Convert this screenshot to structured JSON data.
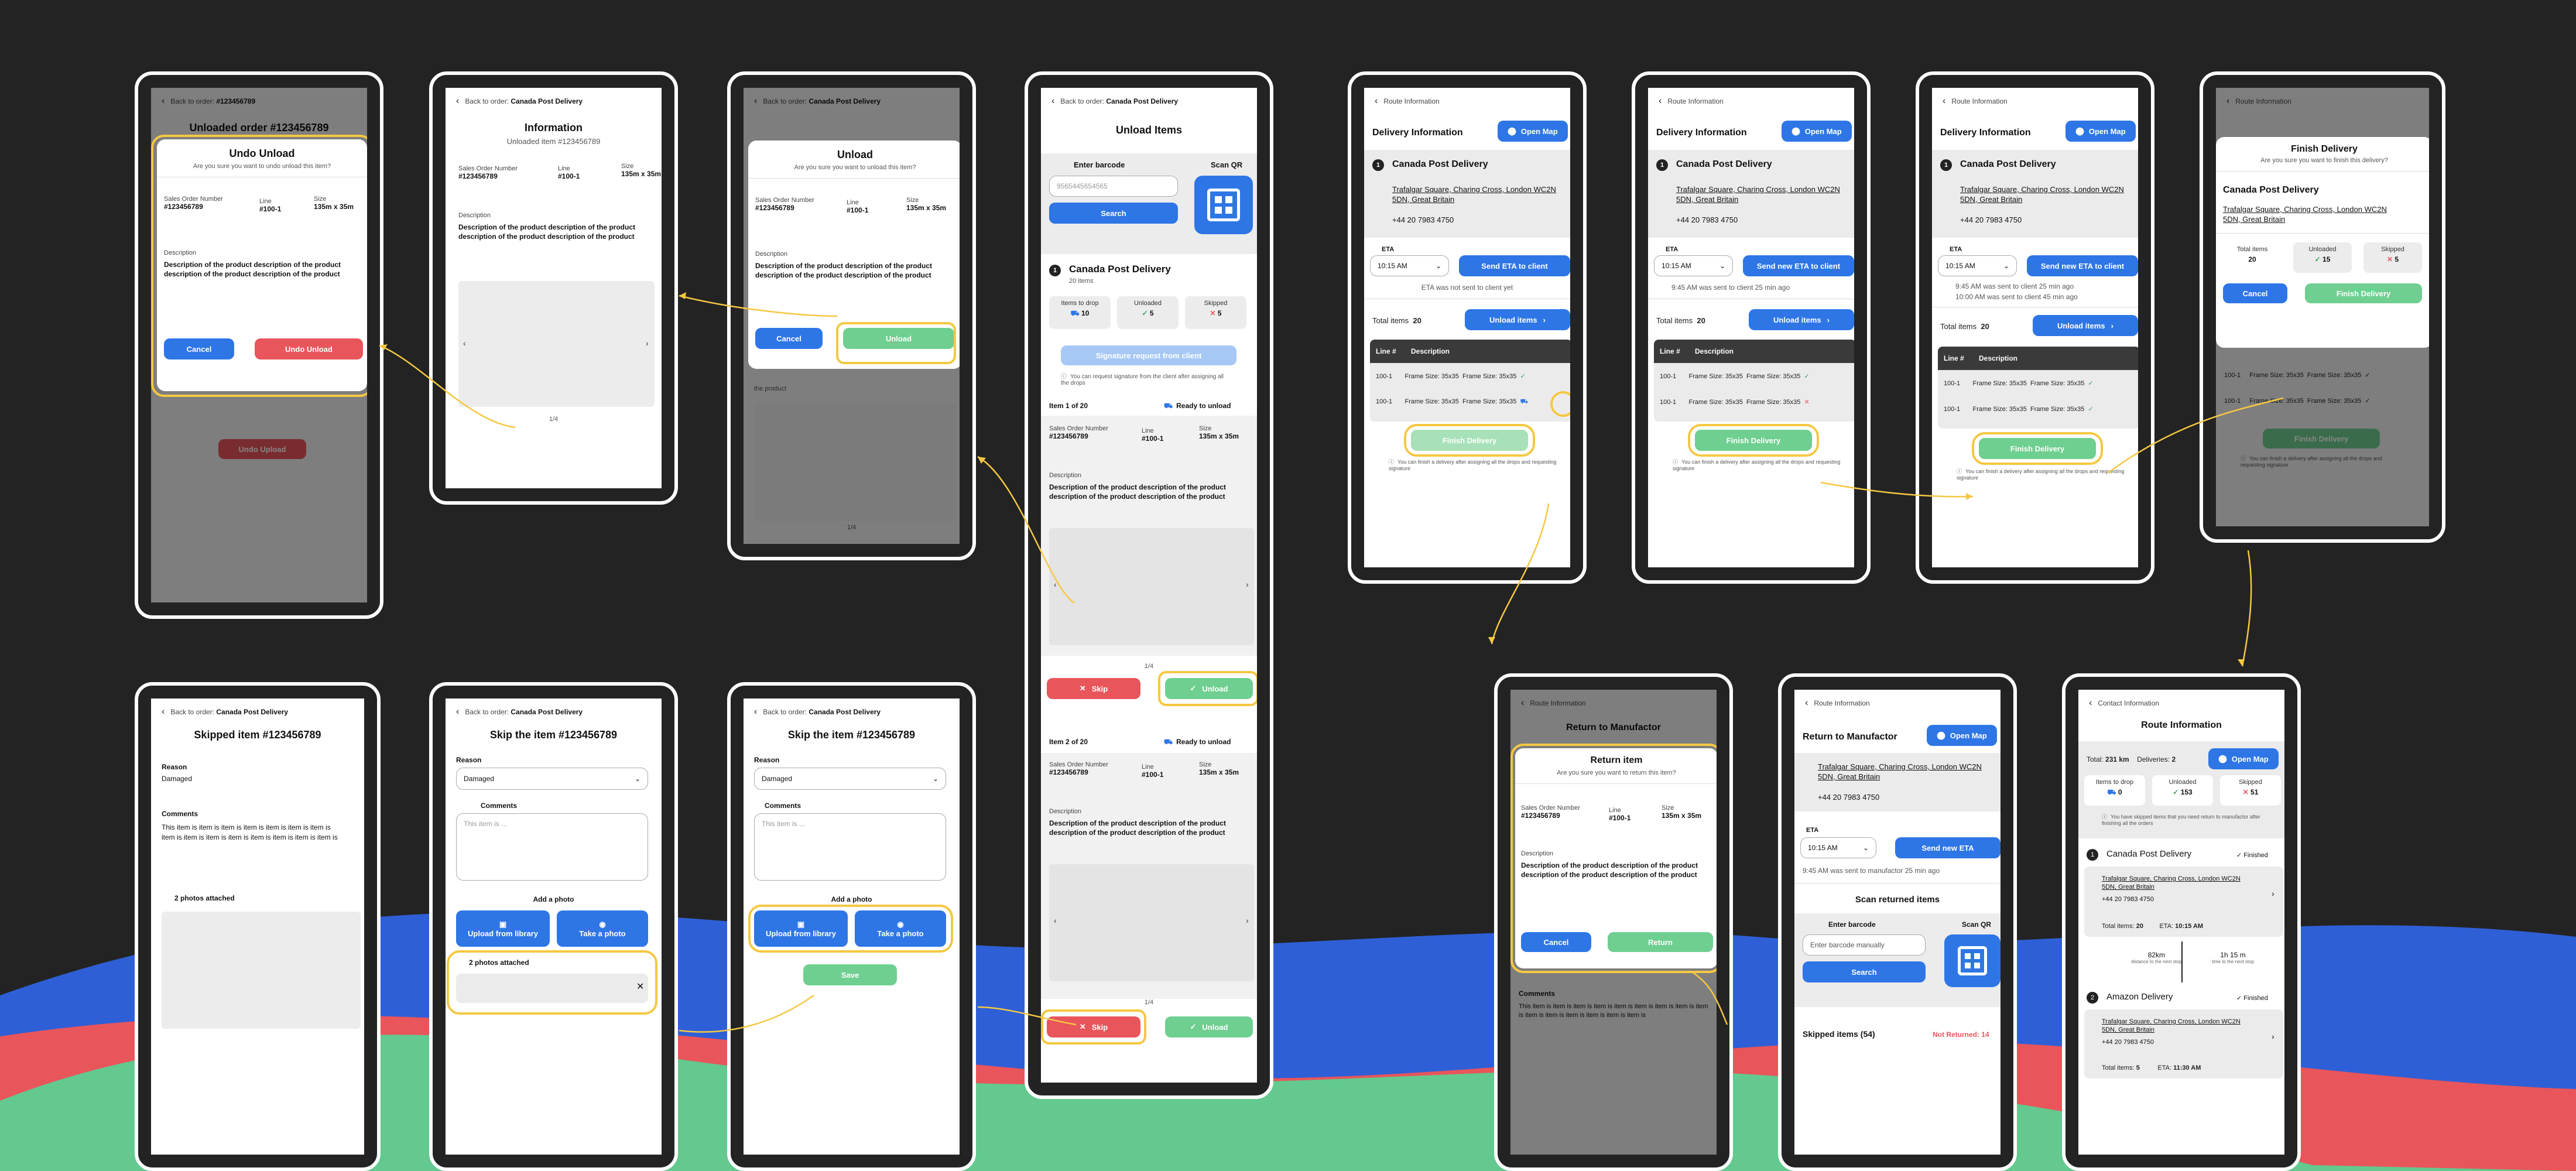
{
  "colors": {
    "background": "#232323",
    "primary_blue": "#2e76e6",
    "success_green": "#6fcf90",
    "danger_red": "#e8555b",
    "highlight_yellow": "#f5c842",
    "wave_blue": "#2f5fd6",
    "wave_red": "#e8555b",
    "wave_green": "#63c98e"
  },
  "icons": [
    "back-chevron-icon",
    "qr-code-icon",
    "map-pin-icon",
    "check-icon",
    "cross-icon",
    "truck-icon",
    "info-icon",
    "close-icon",
    "image-icon",
    "camera-icon",
    "chevron-down-icon",
    "chevron-right-icon",
    "chevron-left-icon"
  ],
  "common": {
    "back_to_order": "Back to order:",
    "order_name": "Canada Post Delivery",
    "order_number": "#123456789",
    "route_information": "Route Information",
    "contact_information": "Contact Information",
    "sales_order_label": "Sales Order Number",
    "sales_order_value": "#123456789",
    "line_label": "Line",
    "line_value": "#100-1",
    "size_label": "Size",
    "size_value": "135m x 35m",
    "description_label": "Description",
    "description_text": "Description of the product description of the product description of the product description of the product",
    "cancel": "Cancel",
    "page_indicator": "1/4",
    "open_map": "Open Map",
    "delivery_information": "Delivery Information",
    "address": "Trafalgar Square, Charing Cross, London WC2N 5DN, Great Britain",
    "phone": "+44 20 7983 4750",
    "eta_label": "ETA",
    "eta_time": "10:15  AM",
    "total_items_label": "Total items",
    "total_items_value": "20",
    "unload_items": "Unload items",
    "line_num": "Line #",
    "frame_size": "Frame Size: 35x35",
    "line_100": "100-1",
    "finish_delivery": "Finish Delivery",
    "finish_note": "You can finish a delivery after assigning all the drops and requesting signature",
    "reason_label": "Reason",
    "reason_value": "Damaged",
    "comments_label": "Comments",
    "comments_placeholder": "This item is ...",
    "add_photo": "Add a photo",
    "upload_library": "Upload from library",
    "take_photo": "Take a photo",
    "photos_attached": "2 photos attached",
    "comment_text": "This item is item is item is item is item is item is item is item is item is item is item is item is item is item is item is"
  },
  "screen_undo_unload": {
    "bg_title": "Unloaded order #123456789",
    "title": "Undo Unload",
    "subtitle": "Are you sure you want to undo unload this item?",
    "confirm": "Undo Unload",
    "bg_button": "Undo Upload"
  },
  "screen_information": {
    "title": "Information",
    "subtitle": "Unloaded item #123456789",
    "button": "Undo Unload"
  },
  "screen_unload_modal": {
    "title": "Unload",
    "subtitle": "Are you sure you want to unload this item?",
    "confirm": "Unload",
    "bg_text": "the product"
  },
  "screen_unload_items": {
    "title": "Unload Items",
    "enter_barcode": "Enter barcode",
    "scan_qr": "Scan QR",
    "barcode_placeholder": "9565445654565",
    "search": "Search",
    "stop_number": "1",
    "stop_name": "Canada Post Delivery",
    "stop_items": "20 items",
    "items_to_drop": "Items to drop",
    "items_to_drop_value": "10",
    "unloaded": "Unloaded",
    "unloaded_value": "5",
    "skipped": "Skipped",
    "skipped_value": "5",
    "signature_request": "Signature request from client",
    "signature_note": "You can request signature from the client after assigning all the drops",
    "item1": "Item 1 of 20",
    "item2": "Item 2 of 20",
    "ready": "Ready to unload",
    "skip": "Skip",
    "unload": "Unload"
  },
  "screen_delivery1": {
    "eta_action": "Send ETA to client",
    "eta_note": "ETA was not sent to client yet"
  },
  "screen_delivery2": {
    "eta_action": "Send new ETA to client",
    "eta_note_time": "9:45 AM",
    "eta_note": "was sent to client 25 min ago"
  },
  "screen_delivery3": {
    "eta_action": "Send new ETA to client",
    "note1_time": "9:45 AM",
    "note1": "was sent to client 25 min ago",
    "note2_time": "10:00 AM",
    "note2": "was sent to client 45 min ago"
  },
  "screen_finish": {
    "title": "Finish Delivery",
    "subtitle": "Are you sure you want to finish this delivery?",
    "name": "Canada Post Delivery",
    "total_items": "Total items",
    "total_value": "20",
    "unloaded": "Unloaded",
    "unloaded_value": "15",
    "skipped": "Skipped",
    "skipped_value": "5",
    "confirm": "Finish Delivery"
  },
  "screen_skipped": {
    "title": "Skipped item #123456789",
    "reason_value": "Damaged"
  },
  "screen_skip1": {
    "title": "Skip the item #123456789"
  },
  "screen_skip2": {
    "title": "Skip the item #123456789",
    "save": "Save"
  },
  "screen_return_modal": {
    "bg_title": "Return to Manufactor",
    "title": "Return item",
    "subtitle": "Are you sure you want to return this item?",
    "confirm": "Return"
  },
  "screen_return": {
    "title": "Return to Manufactor",
    "eta_action": "Send new ETA",
    "eta_note_time": "9:45 AM",
    "eta_note": "was sent to manufactor 25 min ago",
    "scan_returned": "Scan returned items",
    "enter_barcode": "Enter barcode",
    "scan_qr": "Scan QR",
    "barcode_placeholder": "Enter barcode manually",
    "search": "Search",
    "skipped_items": "Skipped items (54)",
    "not_returned": "Not Returned: 14"
  },
  "screen_route": {
    "title": "Route Information",
    "total": "Total:",
    "total_value": "231 km",
    "deliveries": "Deliveries:",
    "deliveries_value": "2",
    "items_to_drop": "Items to drop",
    "items_to_drop_value": "0",
    "unloaded": "Unloaded",
    "unloaded_value": "153",
    "skipped": "Skipped",
    "skipped_value": "51",
    "skip_note": "You have skipped items that you need return to manufactor after finishing all the orders",
    "stop1": "Canada Post Delivery",
    "stop2": "Amazon Delivery",
    "finished": "Finished",
    "total_items": "Total items:",
    "total_items_1": "20",
    "total_items_2": "5",
    "eta": "ETA:",
    "eta_1": "10:15  AM",
    "eta_2": "11:30 AM",
    "distance": "82km",
    "distance_note": "distance to the next stop",
    "time": "1h 15 m",
    "time_note": "time to the next stop"
  }
}
